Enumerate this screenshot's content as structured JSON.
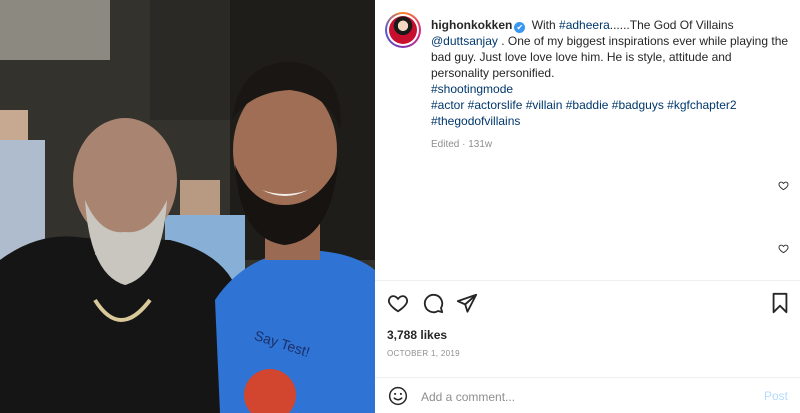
{
  "post": {
    "username": "highonkokken",
    "verified_glyph": "✔",
    "caption_segments": [
      {
        "text": "With ",
        "link": false
      },
      {
        "text": "#adheera",
        "link": true
      },
      {
        "text": "......The God Of Villains ",
        "link": false
      },
      {
        "text": "@duttsanjay",
        "link": true
      },
      {
        "text": " . One of my biggest inspirations ever while playing the bad guy. Just love love love him. He is style, attitude and personality personified.",
        "link": false
      }
    ],
    "hashtag_line1": "#shootingmode",
    "hashtag_line2": "#actor #actorslife #villain #baddie #badguys #kgfchapter2",
    "hashtag_line3": "#thegodofvillains",
    "edited_label": "Edited",
    "age": "131w"
  },
  "stats": {
    "likes": "3,788 likes",
    "date": "OCTOBER 1, 2019"
  },
  "comment": {
    "placeholder": "Add a comment...",
    "post_label": "Post"
  },
  "icons": {
    "caption_like": "heart-outline-icon",
    "like": "heart-icon",
    "comment": "comment-icon",
    "share": "share-icon",
    "save": "bookmark-icon",
    "emoji": "emoji-icon"
  },
  "photo": {
    "shirt_text": "Say Test!"
  },
  "colors": {
    "link": "#00376b",
    "muted": "#8e8e8e",
    "post_disabled": "#b3dbff",
    "verified": "#3897f0"
  }
}
